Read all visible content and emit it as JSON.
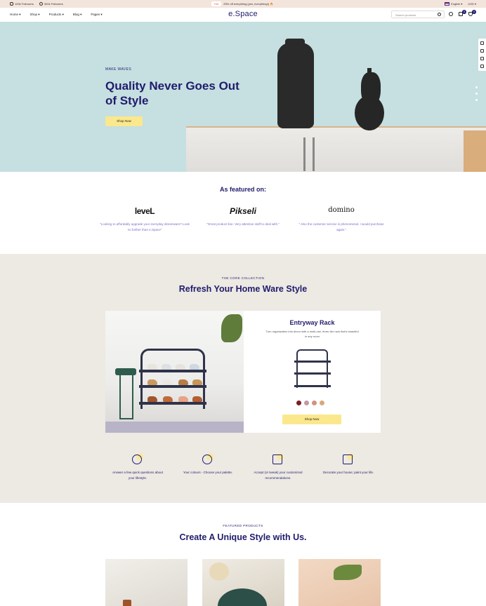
{
  "topbar": {
    "followers_1": "100k Followers",
    "followers_2": "300k Followers",
    "hot_badge": "Hot",
    "promo": "25% off everything (yes, everything!) 🔥",
    "language": "English",
    "currency": "USD"
  },
  "header": {
    "logo": "e.Space",
    "nav": [
      "Home",
      "Shop",
      "Products",
      "Blog",
      "Pages"
    ],
    "search_placeholder": "Search products",
    "wishlist_count": "0",
    "cart_count": "0"
  },
  "hero": {
    "kicker": "MAKE WAVES",
    "title": "Quality Never Goes Out of Style",
    "button": "Shop Now"
  },
  "featured": {
    "title": "As featured on:",
    "brands": [
      {
        "name": "leveL",
        "quote": "\"Looking to affordably upgrade your everyday dinnerware? Look no further than e.Space\""
      },
      {
        "name": "Pikseli",
        "quote": "\"Great product line. Very attentive staff to deal with.\""
      },
      {
        "name": "domino",
        "quote": "\" Also the customer service is phenomenal. I would purchase again.\""
      }
    ]
  },
  "core": {
    "kicker": "THE CORE COLLECTION",
    "title": "Refresh Your Home Ware Style",
    "product_title": "Entryway Rack",
    "product_desc": "Turn organization into decor with a multi-use, three-tier rack that's beautiful in any room",
    "swatches": [
      "#7a1f24",
      "#c39aa2",
      "#d3927f",
      "#d8a77e"
    ],
    "button": "Shop Now",
    "steps": [
      {
        "text": "Answer a few quick questions about your lifestyle."
      },
      {
        "text": "Your colours - Choose your palette."
      },
      {
        "text": "Accept (or tweak) your customized recommendations."
      },
      {
        "text": "Decorate your house; paint your life."
      }
    ]
  },
  "featured_products": {
    "kicker": "FEATURED PRODUCTS",
    "title": "Create A Unique Style with Us."
  }
}
